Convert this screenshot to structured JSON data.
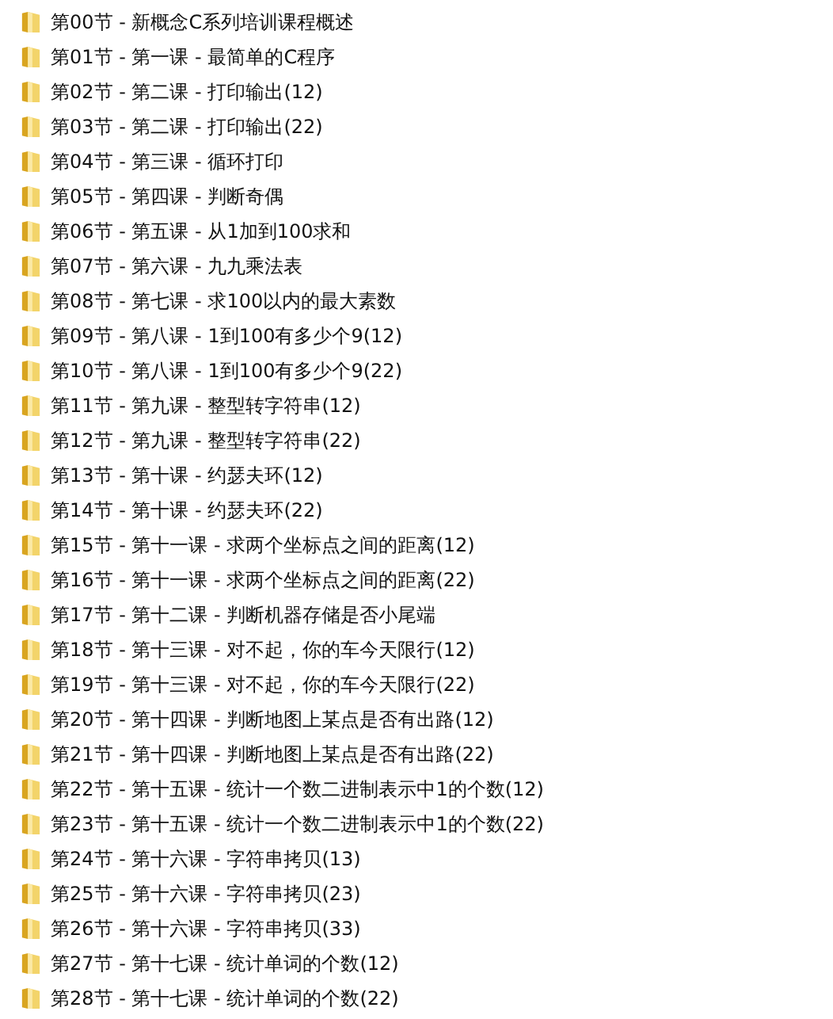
{
  "folders": [
    {
      "label": "第00节 - 新概念C系列培训课程概述"
    },
    {
      "label": "第01节 - 第一课 - 最简单的C程序"
    },
    {
      "label": "第02节 - 第二课 - 打印输出(12)"
    },
    {
      "label": "第03节 - 第二课 - 打印输出(22)"
    },
    {
      "label": "第04节 - 第三课 - 循环打印"
    },
    {
      "label": "第05节 - 第四课 - 判断奇偶"
    },
    {
      "label": "第06节 - 第五课 - 从1加到100求和"
    },
    {
      "label": "第07节 - 第六课 - 九九乘法表"
    },
    {
      "label": "第08节 - 第七课 - 求100以内的最大素数"
    },
    {
      "label": "第09节 - 第八课 - 1到100有多少个9(12)"
    },
    {
      "label": "第10节 - 第八课 - 1到100有多少个9(22)"
    },
    {
      "label": "第11节 - 第九课 - 整型转字符串(12)"
    },
    {
      "label": "第12节 - 第九课 - 整型转字符串(22)"
    },
    {
      "label": "第13节 - 第十课 - 约瑟夫环(12)"
    },
    {
      "label": "第14节 - 第十课 - 约瑟夫环(22)"
    },
    {
      "label": "第15节 - 第十一课 - 求两个坐标点之间的距离(12)"
    },
    {
      "label": "第16节 - 第十一课 - 求两个坐标点之间的距离(22)"
    },
    {
      "label": "第17节 - 第十二课 - 判断机器存储是否小尾端"
    },
    {
      "label": "第18节 - 第十三课 - 对不起，你的车今天限行(12)"
    },
    {
      "label": "第19节 - 第十三课 - 对不起，你的车今天限行(22)"
    },
    {
      "label": "第20节 - 第十四课 - 判断地图上某点是否有出路(12)"
    },
    {
      "label": "第21节 - 第十四课 - 判断地图上某点是否有出路(22)"
    },
    {
      "label": "第22节 - 第十五课 - 统计一个数二进制表示中1的个数(12)"
    },
    {
      "label": "第23节 - 第十五课 - 统计一个数二进制表示中1的个数(22)"
    },
    {
      "label": "第24节 - 第十六课 - 字符串拷贝(13)"
    },
    {
      "label": "第25节 - 第十六课 - 字符串拷贝(23)"
    },
    {
      "label": "第26节 - 第十六课 - 字符串拷贝(33)"
    },
    {
      "label": "第27节 - 第十七课 - 统计单词的个数(12)"
    },
    {
      "label": "第28节 - 第十七课 - 统计单词的个数(22)"
    }
  ]
}
